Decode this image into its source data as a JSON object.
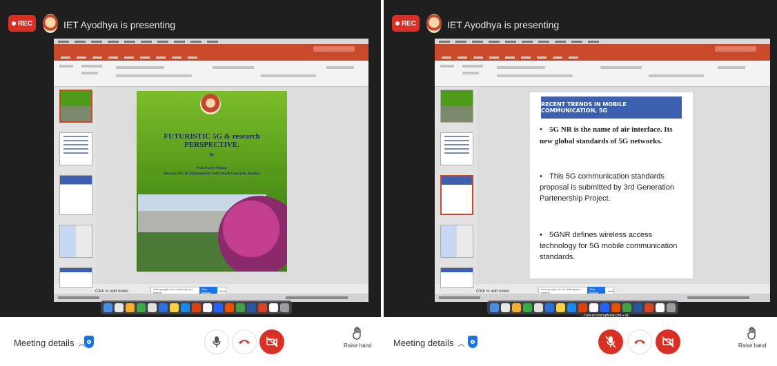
{
  "left": {
    "rec_label": "REC",
    "presenter": "IET Ayodhya is presenting",
    "slide": {
      "title": "FUTURISTIC 5G & research PERSPECTIVE.",
      "by": "By",
      "name": "Prof. Rajesh Mishra",
      "affiliation": "Director, IET, Dr. Rammanohar Lohia Avadh University Ayodhya"
    },
    "notes_hint": "Click to add notes",
    "share_text": "meet.google.com is sharing your screen.",
    "stop_sharing": "Stop sharing",
    "hide": "Hide",
    "meeting_details": "Meeting details",
    "raise_hand": "Raise hand"
  },
  "right": {
    "rec_label": "REC",
    "presenter": "IET Ayodhya is presenting",
    "slide": {
      "heading": "RECENT TRENDS IN MOBILE COMMUNICATION, 5G",
      "bullet1": "5G NR is the name of air interface. Its new global standards of 5G networks.",
      "bullet2": "This 5G communication standards proposal is submitted by 3rd Generation Partenership Project.",
      "bullet3": "5GNR defines wireless access technology for 5G mobile communication standards."
    },
    "notes_hint": "Click to add notes",
    "share_text": "meet.google.com is sharing your screen.",
    "stop_sharing": "Stop sharing",
    "hide": "Hide",
    "tooltip": "Turn on microphone (ctrl + d)",
    "meeting_details": "Meeting details",
    "raise_hand": "Raise hand"
  },
  "colors": {
    "rec_red": "#d93025",
    "ppt_orange": "#c84a2b",
    "slide_heading_blue": "#3c5fb0",
    "shield_blue": "#1a73e8"
  },
  "icons": [
    "mic-icon",
    "mic-off-icon",
    "hangup-icon",
    "camera-off-icon",
    "raise-hand-icon",
    "shield-icon",
    "chevron-up-icon"
  ]
}
